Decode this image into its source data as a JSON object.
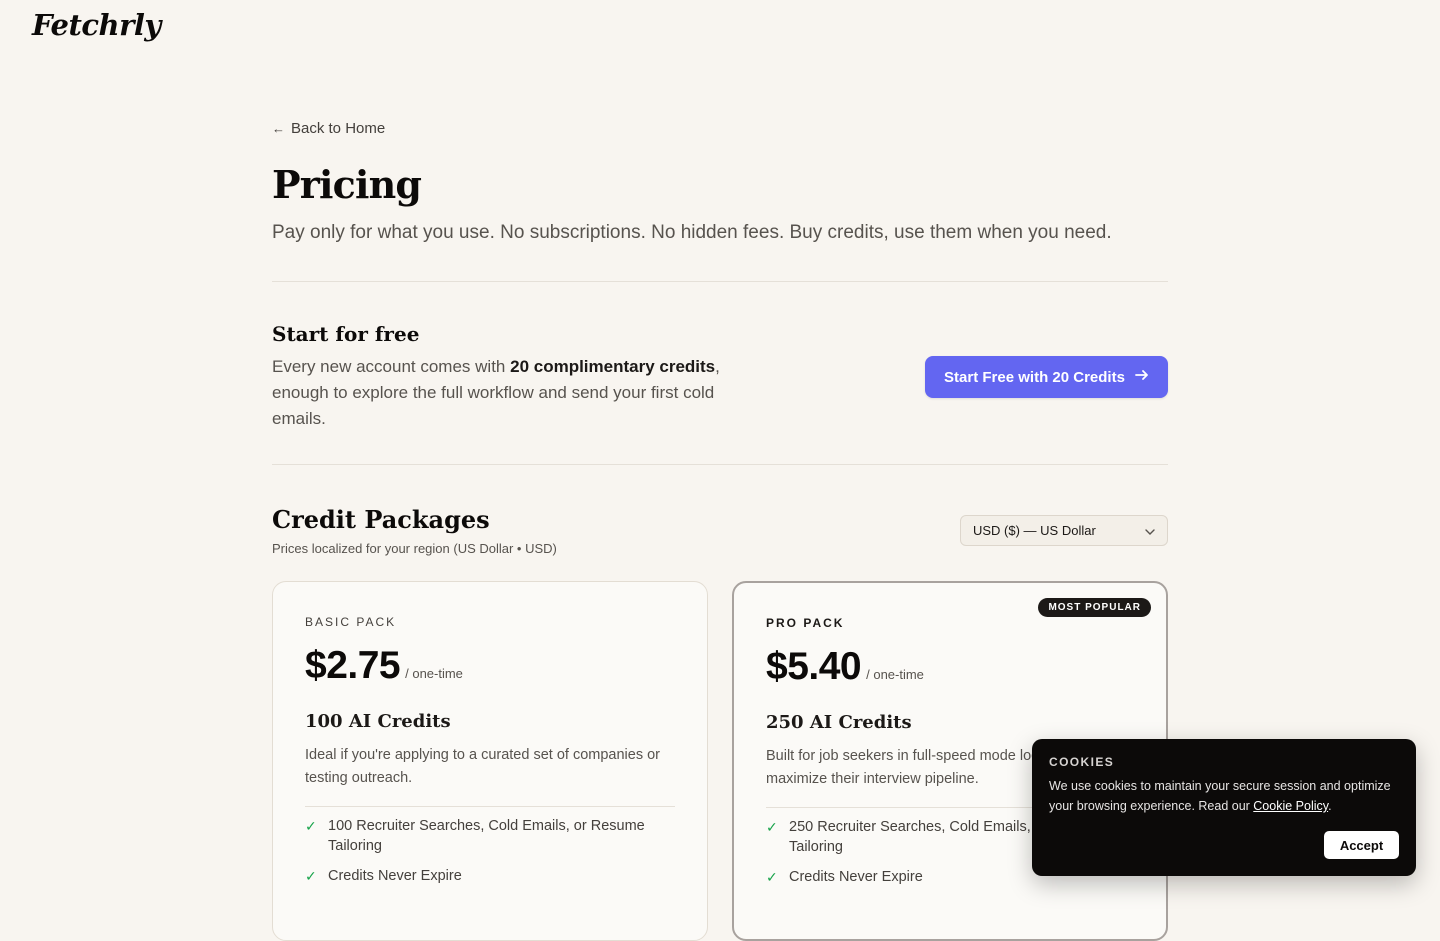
{
  "header": {
    "logo": "Fetchrly"
  },
  "nav": {
    "back_label": "Back to Home"
  },
  "page": {
    "title": "Pricing",
    "subtitle": "Pay only for what you use. No subscriptions. No hidden fees. Buy credits, use them when you need."
  },
  "free": {
    "title": "Start for free",
    "desc_before": "Every new account comes with ",
    "desc_bold": "20 complimentary credits",
    "desc_after": ", enough to explore the full workflow and send your first cold emails.",
    "cta_label": "Start Free with 20 Credits",
    "cta_color": "#6366f1"
  },
  "packages": {
    "title": "Credit Packages",
    "subtitle": "Prices localized for your region (US Dollar • USD)",
    "currency_selected": "USD ($) — US Dollar",
    "cards": [
      {
        "name": "BASIC PACK",
        "price": "$2.75",
        "price_suffix": "/ one-time",
        "credits": "100 AI Credits",
        "desc": "Ideal if you're applying to a curated set of companies or testing outreach.",
        "features": [
          "100 Recruiter Searches, Cold Emails, or Resume Tailoring",
          "Credits Never Expire"
        ]
      },
      {
        "name": "PRO PACK",
        "badge": "MOST POPULAR",
        "price": "$5.40",
        "price_suffix": "/ one-time",
        "credits": "250 AI Credits",
        "desc": "Built for job seekers in full-speed mode looking to maximize their interview pipeline.",
        "features": [
          "250 Recruiter Searches, Cold Emails, or Resume Tailoring",
          "Credits Never Expire"
        ]
      }
    ]
  },
  "cookie": {
    "title": "COOKIES",
    "text": "We use cookies to maintain your secure session and optimize your browsing experience. Read our ",
    "link_label": "Cookie Policy",
    "text_end": ".",
    "accept_label": "Accept"
  }
}
